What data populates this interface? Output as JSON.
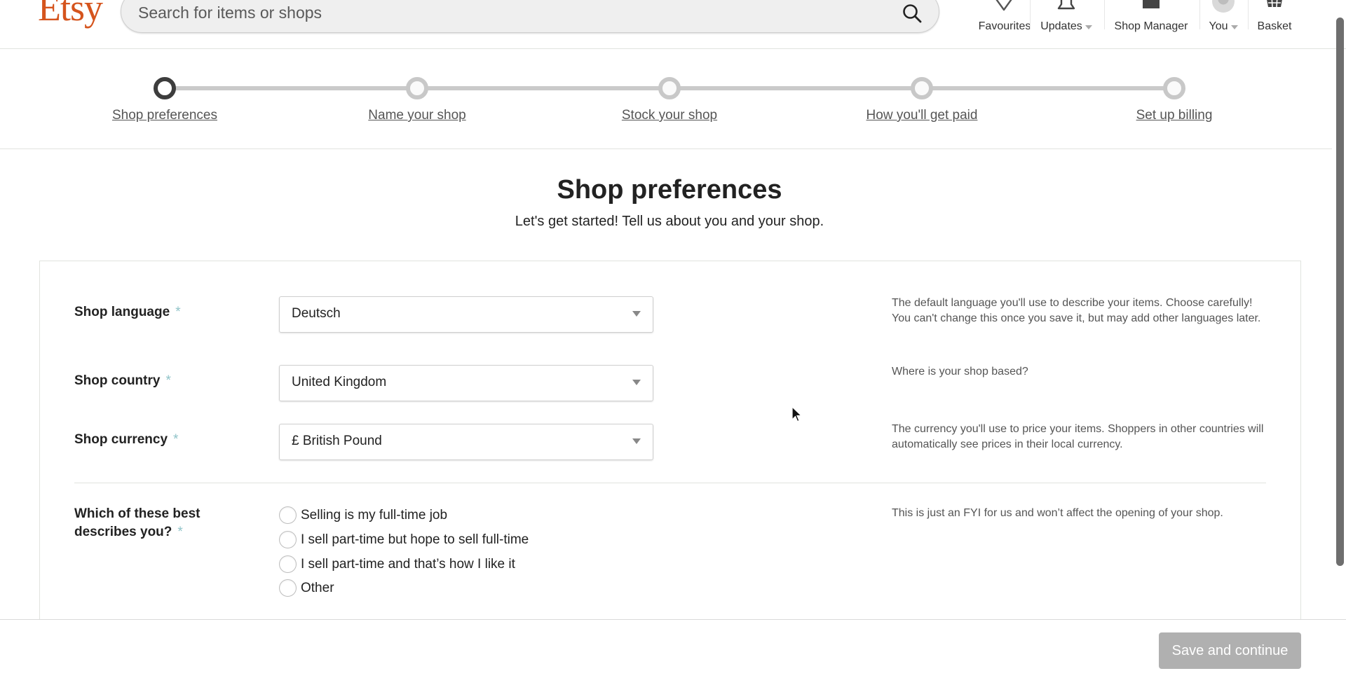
{
  "header": {
    "logo": "Etsy",
    "search": {
      "placeholder": "Search for items or shops",
      "value": ""
    },
    "nav": [
      {
        "label": "Favourites",
        "icon": "heart-icon",
        "has_caret": false
      },
      {
        "label": "Updates",
        "icon": "bell-icon",
        "has_caret": true
      },
      {
        "label": "Shop Manager",
        "icon": "shop-icon",
        "has_caret": false
      },
      {
        "label": "You",
        "icon": "avatar",
        "has_caret": true
      },
      {
        "label": "Basket",
        "icon": "basket-icon",
        "has_caret": false
      }
    ]
  },
  "stepper": {
    "current_step": 1,
    "steps": [
      {
        "label": "Shop preferences",
        "state": "active"
      },
      {
        "label": "Name your shop",
        "state": "upcoming"
      },
      {
        "label": "Stock your shop",
        "state": "upcoming"
      },
      {
        "label": "How you'll get paid",
        "state": "upcoming"
      },
      {
        "label": "Set up billing",
        "state": "upcoming"
      }
    ]
  },
  "page": {
    "title": "Shop preferences",
    "subtitle": "Let's get started! Tell us about you and your shop."
  },
  "form": {
    "required_marker": "*",
    "language": {
      "label": "Shop language",
      "value": "Deutsch",
      "help": "The default language you'll use to describe your items. Choose carefully! You can't change this once you save it, but may add other languages later."
    },
    "country": {
      "label": "Shop country",
      "value": "United Kingdom",
      "help": "Where is your shop based?"
    },
    "currency": {
      "label": "Shop currency",
      "value": "£ British Pound",
      "help": "The currency you'll use to price your items. Shoppers in other countries will automatically see prices in their local currency."
    },
    "describes_you": {
      "label": "Which of these best describes you?",
      "help": "This is just an FYI for us and won’t affect the opening of your shop.",
      "options": [
        {
          "label": "Selling is my full-time job",
          "selected": false
        },
        {
          "label": "I sell part-time but hope to sell full-time",
          "selected": false
        },
        {
          "label": "I sell part-time and that’s how I like it",
          "selected": false
        },
        {
          "label": "Other",
          "selected": false
        }
      ]
    }
  },
  "footer": {
    "save_label": "Save and continue",
    "save_enabled": false
  },
  "colors": {
    "brand": "#d5541d",
    "required_marker": "#8fc3c8",
    "step_active": "#3d3d3d",
    "step_inactive": "#c8c8c8",
    "button_disabled": "#b0b0b0"
  }
}
